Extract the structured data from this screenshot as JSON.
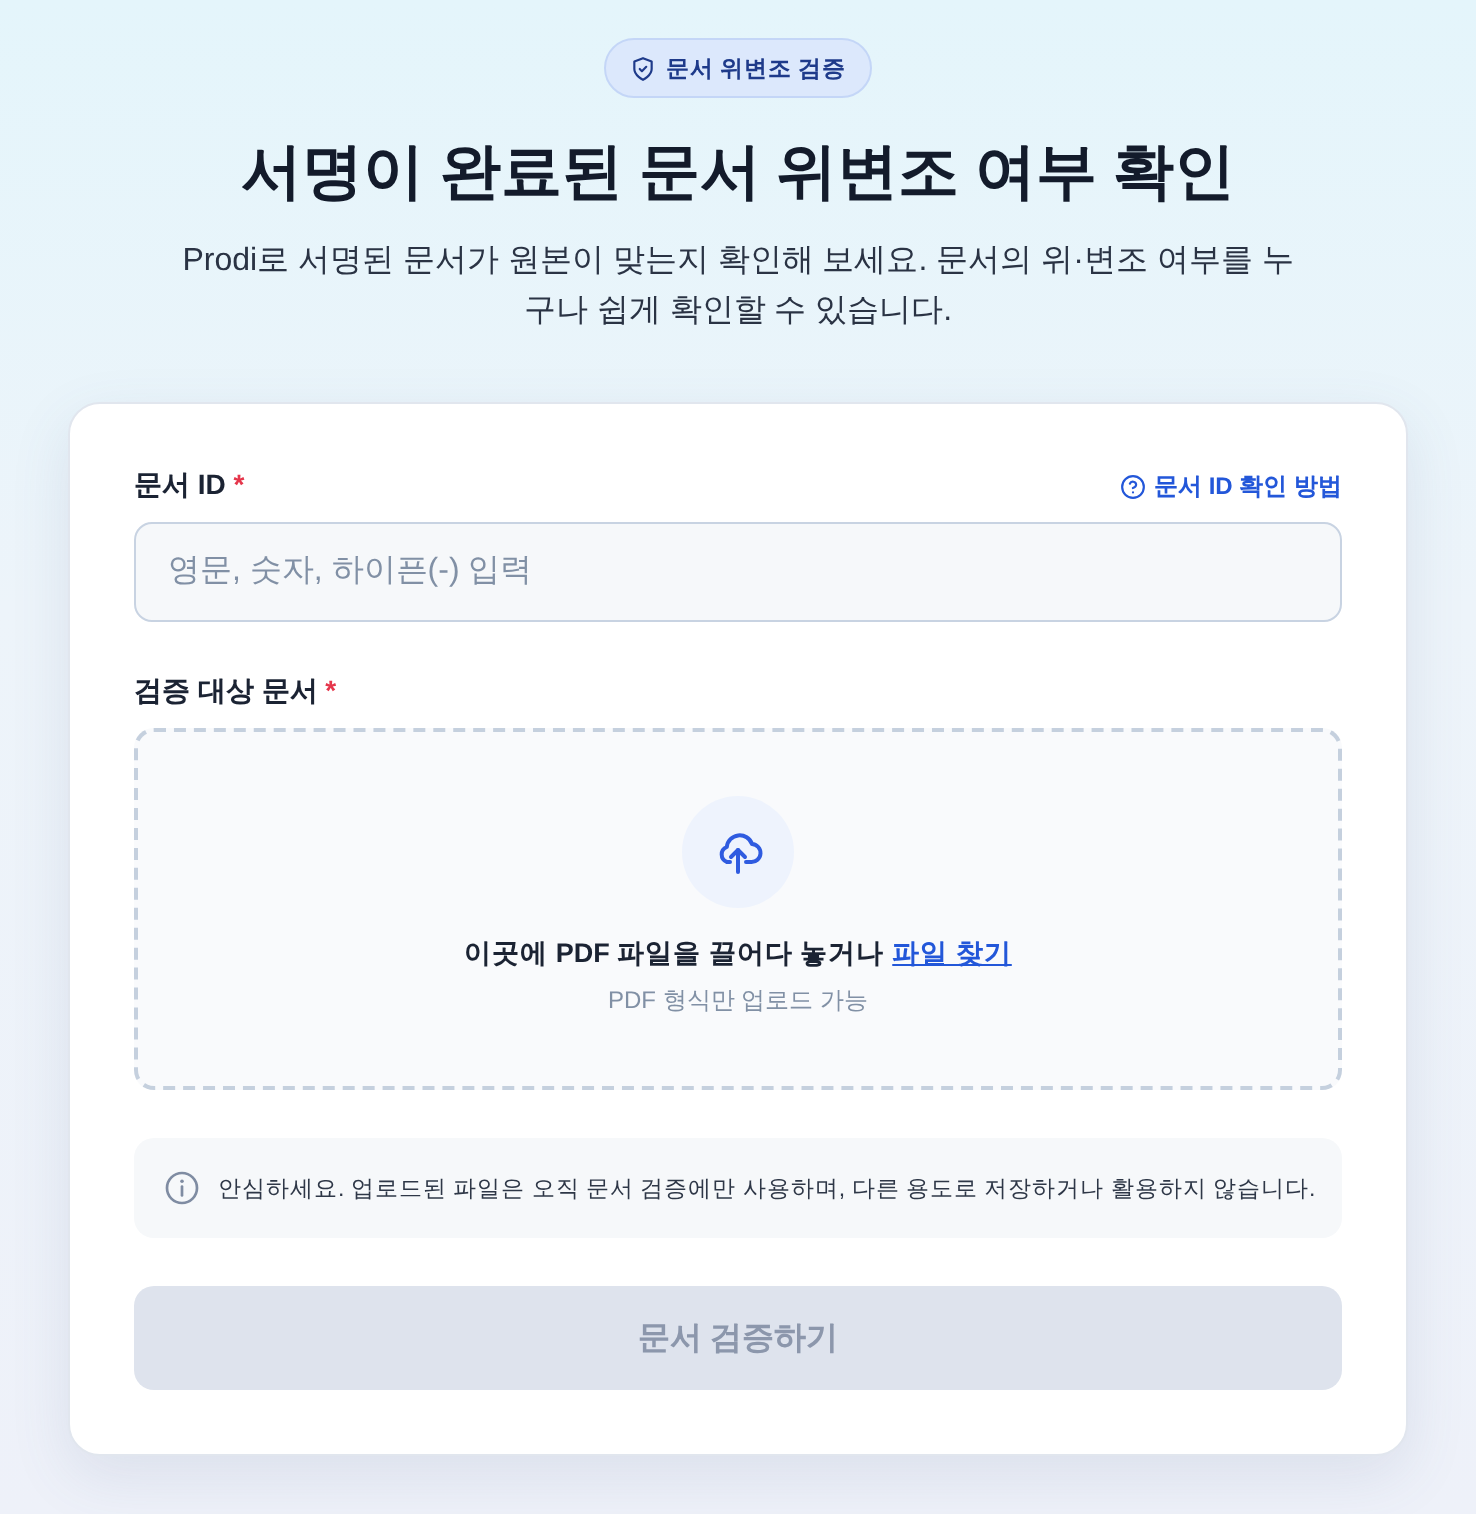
{
  "badge": {
    "label": "문서 위변조 검증"
  },
  "heading": "서명이 완료된 문서 위변조 여부 확인",
  "subtitle": "Prodi로 서명된 문서가 원본이 맞는지 확인해 보세요. 문서의 위·변조 여부를 누구나 쉽게 확인할 수 있습니다.",
  "form": {
    "fields": [
      {
        "kind": "text",
        "label": "문서 ID",
        "required_mark": "*",
        "help_link": "문서 ID 확인 방법",
        "placeholder": "영문, 숫자, 하이픈(-) 입력"
      },
      {
        "kind": "upload",
        "label": "검증 대상 문서",
        "required_mark": "*",
        "prompt": "이곳에 PDF 파일을 끌어다 놓거나",
        "browse_link": "파일 찾기",
        "hint": "PDF 형식만 업로드 가능"
      }
    ],
    "notice": "안심하세요. 업로드된 파일은 오직 문서 검증에만 사용하며, 다른 용도로 저장하거나 활용하지 않습니다.",
    "submit": {
      "label": "문서 검증하기",
      "disabled": true
    }
  }
}
